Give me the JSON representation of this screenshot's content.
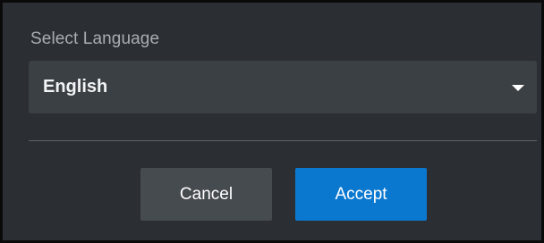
{
  "dialog": {
    "label": "Select Language",
    "select": {
      "value": "English",
      "icon": "chevron-down-icon"
    },
    "buttons": {
      "cancel": "Cancel",
      "accept": "Accept"
    },
    "colors": {
      "background": "#2b2f33",
      "select_bg": "#3b4044",
      "cancel_bg": "#464b50",
      "accept_bg": "#0b78d0"
    }
  }
}
